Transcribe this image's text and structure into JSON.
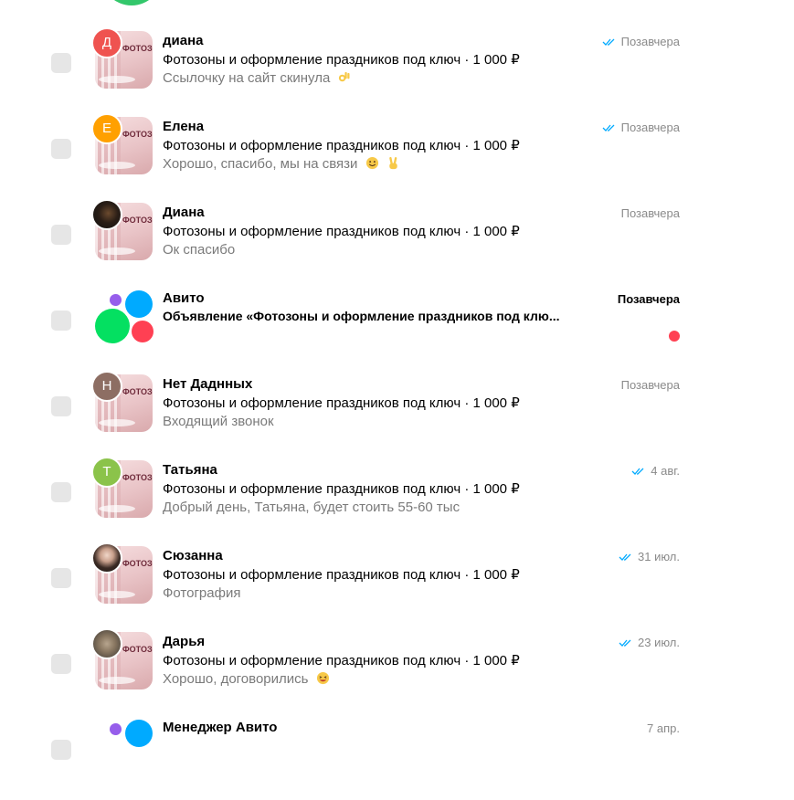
{
  "colors": {
    "avito_green": "#04e061",
    "avito_blue": "#00aaff",
    "avito_red": "#ff4053",
    "avito_purple": "#965eeb",
    "read_tick": "#00aaff",
    "unread_dot": "#ff4053"
  },
  "chats": [
    {
      "name": "диана",
      "subject": "Фотозоны и оформление праздников под ключ · 1 000 ₽",
      "preview": "Ссылочку на сайт скинула",
      "preview_emoji": "ok-hand",
      "date": "Позавчера",
      "read": true,
      "avatar_letter": "Д",
      "avatar_color": "#ef5350"
    },
    {
      "name": "Елена",
      "subject": "Фотозоны и оформление праздников под ключ · 1 000 ₽",
      "preview": "Хорошо, спасибо, мы на связи",
      "preview_emoji": "smile, victory-hand",
      "date": "Позавчера",
      "read": true,
      "avatar_letter": "Е",
      "avatar_color": "#ffa000"
    },
    {
      "name": "Диана",
      "subject": "Фотозоны и оформление праздников под ключ · 1 000 ₽",
      "preview": "Ок спасибо",
      "date": "Позавчера",
      "read": false,
      "avatar_icon": "photo-avatar"
    },
    {
      "name": "Авито",
      "subject": "Объявление «Фотозоны и оформление праздников под клю...",
      "preview": "",
      "date": "Позавчера",
      "unread": true,
      "avatar_icon": "avito-logo"
    },
    {
      "name": "Нет Даднных",
      "subject": "Фотозоны и оформление праздников под ключ · 1 000 ₽",
      "preview": "Входящий звонок",
      "date": "Позавчера",
      "read": false,
      "avatar_letter": "Н",
      "avatar_color": "#8d6e63"
    },
    {
      "name": "Татьяна",
      "subject": "Фотозоны и оформление праздников под ключ · 1 000 ₽",
      "preview": "Добрый день, Татьяна, будет стоить 55-60 тыс",
      "date": "4 авг.",
      "read": true,
      "avatar_letter": "Т",
      "avatar_color": "#8bc34a"
    },
    {
      "name": "Сюзанна",
      "subject": "Фотозоны и оформление праздников под ключ · 1 000 ₽",
      "preview": "Фотография",
      "date": "31 июл.",
      "read": true,
      "avatar_icon": "photo-avatar"
    },
    {
      "name": "Дарья",
      "subject": "Фотозоны и оформление праздников под ключ · 1 000 ₽",
      "preview": "Хорошо, договорились",
      "preview_emoji": "grin",
      "date": "23 июл.",
      "read": true,
      "avatar_icon": "photo-avatar"
    },
    {
      "name": "Менеджер Авито",
      "subject": "",
      "preview": "",
      "date": "7 апр.",
      "read": false,
      "avatar_icon": "avito-logo"
    }
  ],
  "thumbnail_text": "ФОТОЗОНЫ ПОД КЛЮ",
  "icons": [
    "double-check-icon",
    "unread-dot",
    "avito-logo"
  ]
}
